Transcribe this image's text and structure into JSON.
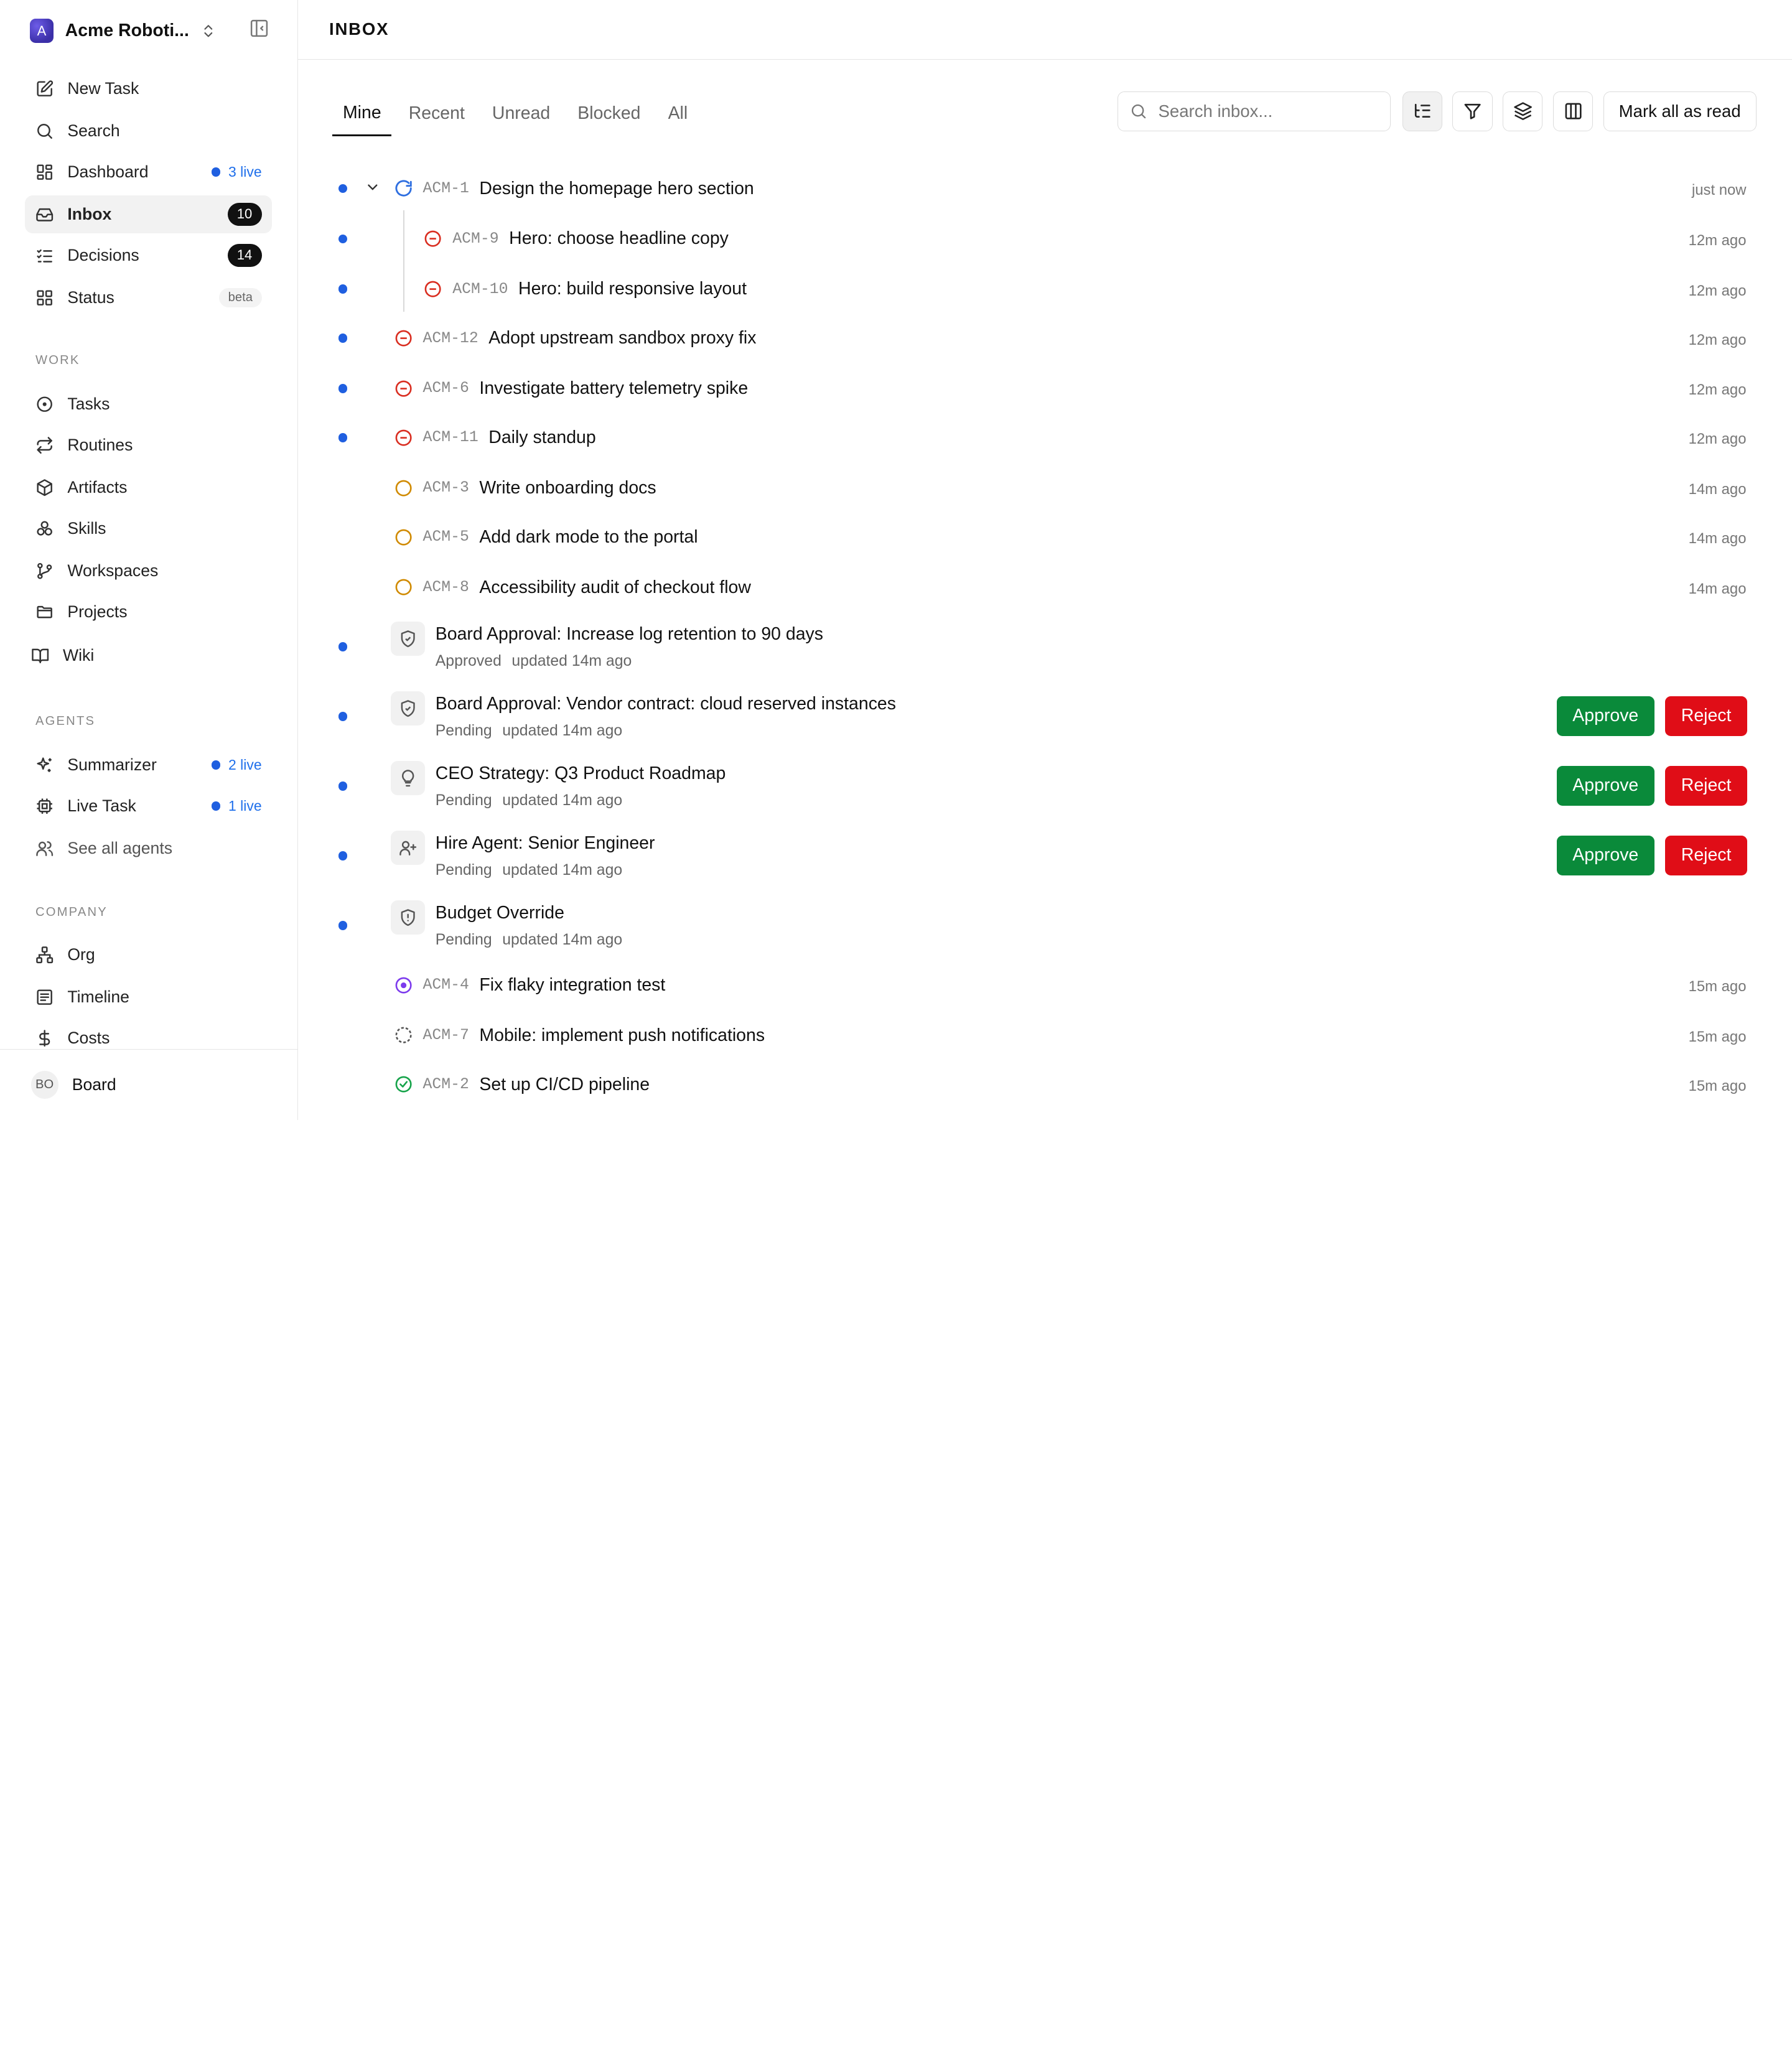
{
  "sidebar": {
    "brand": {
      "logo_letter": "A",
      "name": "Acme Roboti..."
    },
    "items": [
      {
        "label": "New Task",
        "icon": "edit-icon"
      },
      {
        "label": "Search",
        "icon": "search-icon"
      },
      {
        "label": "Dashboard",
        "icon": "dashboard-icon",
        "live": "3 live"
      },
      {
        "label": "Inbox",
        "icon": "inbox-icon",
        "count": "10",
        "active": true
      },
      {
        "label": "Decisions",
        "icon": "decisions-icon",
        "count": "14"
      },
      {
        "label": "Status",
        "icon": "status-icon",
        "badge": "beta"
      }
    ],
    "work_title": "WORK",
    "work": [
      {
        "label": "Tasks",
        "icon": "tasks-icon"
      },
      {
        "label": "Routines",
        "icon": "routines-icon"
      },
      {
        "label": "Artifacts",
        "icon": "box-icon"
      },
      {
        "label": "Skills",
        "icon": "skills-icon"
      },
      {
        "label": "Workspaces",
        "icon": "git-branch-icon"
      },
      {
        "label": "Projects",
        "icon": "folder-icon"
      },
      {
        "label": "Wiki",
        "icon": "book-icon"
      }
    ],
    "agents_title": "AGENTS",
    "agents": [
      {
        "label": "Summarizer",
        "icon": "sparkles-icon",
        "live": "2 live"
      },
      {
        "label": "Live Task",
        "icon": "cpu-icon",
        "live": "1 live"
      },
      {
        "label": "See all agents",
        "icon": "users-icon"
      }
    ],
    "company_title": "COMPANY",
    "company": [
      {
        "label": "Org",
        "icon": "org-icon"
      },
      {
        "label": "Timeline",
        "icon": "timeline-icon"
      },
      {
        "label": "Costs",
        "icon": "dollar-icon"
      }
    ],
    "footer": {
      "initials": "BO",
      "name": "Board"
    }
  },
  "header": {
    "title": "INBOX"
  },
  "tabs": [
    "Mine",
    "Recent",
    "Unread",
    "Blocked",
    "All"
  ],
  "toolbar": {
    "search_placeholder": "Search inbox...",
    "mark_all": "Mark all as read"
  },
  "issues": [
    {
      "id": "ACM-1",
      "title": "Design the homepage hero section",
      "time": "just now",
      "status": "in-progress",
      "unread": true
    },
    {
      "id": "ACM-9",
      "title": "Hero: choose headline copy",
      "time": "12m ago",
      "status": "blocked",
      "unread": true
    },
    {
      "id": "ACM-10",
      "title": "Hero: build responsive layout",
      "time": "12m ago",
      "status": "blocked",
      "unread": true
    },
    {
      "id": "ACM-12",
      "title": "Adopt upstream sandbox proxy fix",
      "time": "12m ago",
      "status": "blocked",
      "unread": true
    },
    {
      "id": "ACM-6",
      "title": "Investigate battery telemetry spike",
      "time": "12m ago",
      "status": "blocked",
      "unread": true
    },
    {
      "id": "ACM-11",
      "title": "Daily standup",
      "time": "12m ago",
      "status": "blocked",
      "unread": true
    },
    {
      "id": "ACM-3",
      "title": "Write onboarding docs",
      "time": "14m ago",
      "status": "todo",
      "unread": false
    },
    {
      "id": "ACM-5",
      "title": "Add dark mode to the portal",
      "time": "14m ago",
      "status": "todo",
      "unread": false
    },
    {
      "id": "ACM-8",
      "title": "Accessibility audit of checkout flow",
      "time": "14m ago",
      "status": "todo",
      "unread": false
    }
  ],
  "approvals": [
    {
      "title": "Board Approval: Increase log retention to 90 days",
      "status": "Approved",
      "updated": "updated 14m ago",
      "icon": "shield-check-icon",
      "actions": false
    },
    {
      "title": "Board Approval: Vendor contract: cloud reserved instances",
      "status": "Pending",
      "updated": "updated 14m ago",
      "icon": "shield-check-icon",
      "actions": true
    },
    {
      "title": "CEO Strategy: Q3 Product Roadmap",
      "status": "Pending",
      "updated": "updated 14m ago",
      "icon": "lightbulb-icon",
      "actions": true
    },
    {
      "title": "Hire Agent: Senior Engineer",
      "status": "Pending",
      "updated": "updated 14m ago",
      "icon": "user-plus-icon",
      "actions": true
    },
    {
      "title": "Budget Override",
      "status": "Pending",
      "updated": "updated 14m ago",
      "icon": "shield-alert-icon",
      "actions": false
    }
  ],
  "actions": {
    "approve": "Approve",
    "reject": "Reject"
  },
  "more_issues": [
    {
      "id": "ACM-4",
      "title": "Fix flaky integration test",
      "time": "15m ago",
      "status": "in-review"
    },
    {
      "id": "ACM-7",
      "title": "Mobile: implement push notifications",
      "time": "15m ago",
      "status": "backlog"
    },
    {
      "id": "ACM-2",
      "title": "Set up CI/CD pipeline",
      "time": "15m ago",
      "status": "done"
    }
  ],
  "colors": {
    "unread": "#1f5fe0",
    "approve": "#0a8a3a",
    "reject": "#e00d17",
    "blocked": "#d92d20",
    "todo": "#d08a00",
    "in_progress": "#2f6fe0",
    "in_review": "#7c3aed",
    "done": "#16a34a"
  }
}
